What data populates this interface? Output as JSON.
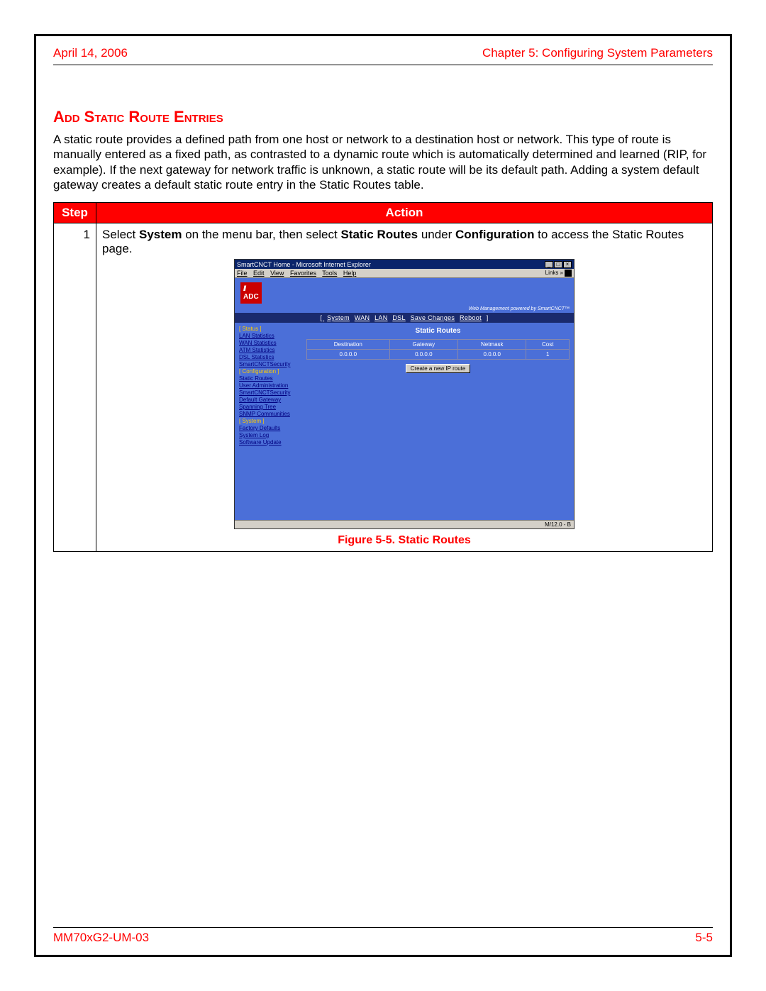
{
  "header": {
    "left": "April 14, 2006",
    "right": "Chapter 5: Configuring System Parameters"
  },
  "footer": {
    "left": "MM70xG2-UM-03",
    "right": "5-5"
  },
  "section_title": "Add Static Route Entries",
  "body_text": "A static route provides a defined path from one host or network to a destination host or network. This type of route is manually entered as a fixed path, as contrasted to a dynamic route which is automatically determined and learned (RIP, for example). If the next gateway for network traffic is unknown, a static route will be its default path. Adding a system default gateway creates a default static route entry in the Static Routes table.",
  "table": {
    "head_step": "Step",
    "head_action": "Action",
    "step_num": "1",
    "action_pre": "Select ",
    "action_b1": "System",
    "action_mid1": " on the menu bar, then select ",
    "action_b2": "Static Routes",
    "action_mid2": " under ",
    "action_b3": "Configuration",
    "action_post": " to access the Static Routes page."
  },
  "figure_caption": "Figure 5-5. Static Routes",
  "shot": {
    "title": "SmartCNCT Home - Microsoft Internet Explorer",
    "menus": [
      "File",
      "Edit",
      "View",
      "Favorites",
      "Tools",
      "Help"
    ],
    "links_label": "Links",
    "logo_text": "ADC",
    "tagline": "Web Management powered by SmartCNCT™",
    "nav_left": "[ ",
    "nav_items": [
      "System",
      "WAN",
      "LAN",
      "DSL",
      "Save Changes",
      "Reboot"
    ],
    "nav_right": " ]",
    "sidebar": {
      "status_hdr": "[ Status ]",
      "status_links": [
        "LAN Statistics",
        "WAN Statistics",
        "ATM Statistics",
        "DSL Statistics",
        "SmartCNCTSecurity"
      ],
      "config_hdr": "[ Configuration ]",
      "config_links": [
        "Static Routes",
        "User Administration",
        "SmartCNCTSecurity",
        "Default Gateway",
        "Spanning Tree",
        "SNMP Communities"
      ],
      "system_hdr": "[ System ]",
      "system_links": [
        "Factory Defaults",
        "System Log",
        "Software Update"
      ]
    },
    "panel_title": "Static Routes",
    "routes": {
      "headers": [
        "Destination",
        "Gateway",
        "Netmask",
        "Cost"
      ],
      "row": [
        "0.0.0.0",
        "0.0.0.0",
        "0.0.0.0",
        "1"
      ]
    },
    "button": "Create a new IP route",
    "status": "M/12.0 - B"
  }
}
